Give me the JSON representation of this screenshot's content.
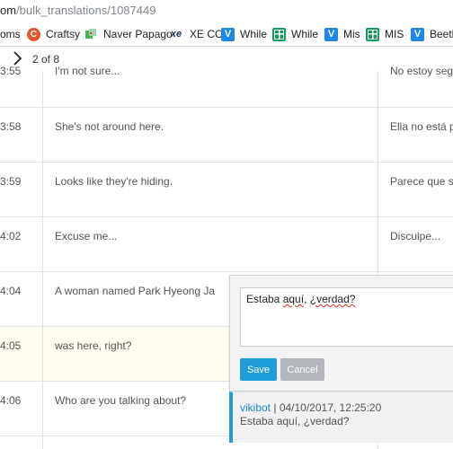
{
  "browser": {
    "url_host": "om",
    "url_path": "/bulk_translations/1087449",
    "bookmarks": [
      {
        "label": "oms",
        "icon": "none"
      },
      {
        "label": "Craftsy",
        "icon": "craftsy-icon"
      },
      {
        "label": "Naver Papago",
        "icon": "papago-icon"
      },
      {
        "label": "XE CC",
        "icon": "xe-icon"
      },
      {
        "label": "While",
        "icon": "v-icon"
      },
      {
        "label": "While",
        "icon": "sheets-icon"
      },
      {
        "label": "Mis",
        "icon": "v-icon"
      },
      {
        "label": "MIS",
        "icon": "sheets-icon"
      },
      {
        "label": "Beeth",
        "icon": "v-icon"
      }
    ]
  },
  "pager": {
    "count": "2 of 8"
  },
  "rows": [
    {
      "time": "3:55",
      "source": "I'm not sure...",
      "target": "No estoy seg"
    },
    {
      "time": "3:58",
      "source": "She's not around here.",
      "target": "Ella no está p"
    },
    {
      "time": "3:59",
      "source": "Looks like they're hiding.",
      "target": "Parece que s"
    },
    {
      "time": "4:02",
      "source": "Excuse me...",
      "target": "Disculpe..."
    },
    {
      "time": "4:04",
      "source": "A woman named Park Hyeong Ja",
      "target": ""
    },
    {
      "time": "4:05",
      "source": "was here, right?",
      "target": ""
    },
    {
      "time": "4:06",
      "source": "Who are you talking about?",
      "target": ""
    }
  ],
  "editor": {
    "value": "Estaba aquí, ¿verdad?",
    "value_parts": [
      "Estaba ",
      "aquí",
      ", ",
      "¿verdad?"
    ],
    "save_label": "Save",
    "cancel_label": "Cancel"
  },
  "history": {
    "user": "vikibot",
    "separator": " | ",
    "timestamp": "04/10/2017, 12:25:20",
    "text": "Estaba aquí, ¿verdad?"
  },
  "colors": {
    "accent": "#1e9dd8",
    "active_row": "#fffdf0",
    "grid": "#dfe3e8"
  }
}
